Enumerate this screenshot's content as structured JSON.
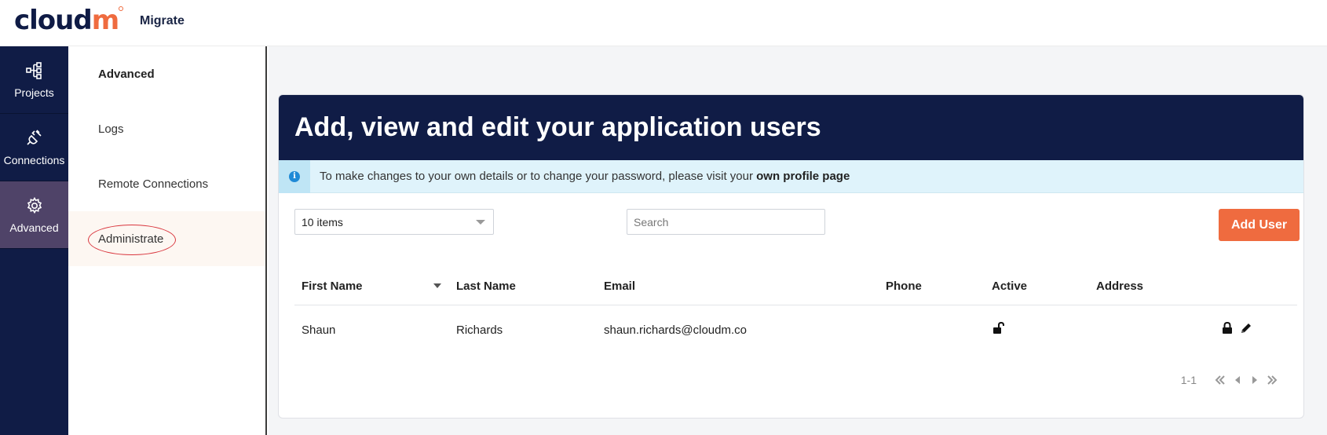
{
  "header": {
    "logo_main": "cloud",
    "logo_accent": "m",
    "app_title": "Migrate"
  },
  "rail": {
    "items": [
      {
        "label": "Projects",
        "icon": "project-tree-icon"
      },
      {
        "label": "Connections",
        "icon": "plug-icon"
      },
      {
        "label": "Advanced",
        "icon": "gear-icon",
        "active": true
      }
    ]
  },
  "subnav": {
    "heading": "Advanced",
    "items": [
      {
        "label": "Logs"
      },
      {
        "label": "Remote Connections"
      },
      {
        "label": "Administrate",
        "selected": true
      }
    ]
  },
  "card": {
    "title": "Add, view and edit your application users",
    "info_text": "To make changes to your own details or to change your password, please visit your",
    "info_link": "own profile page",
    "page_size": "10 items",
    "search_placeholder": "Search",
    "add_button": "Add User"
  },
  "table": {
    "columns": [
      "First Name",
      "Last Name",
      "Email",
      "Phone",
      "Active",
      "Address"
    ],
    "rows": [
      {
        "first_name": "Shaun",
        "last_name": "Richards",
        "email": "shaun.richards@cloudm.co",
        "phone": "",
        "active_icon": "unlock-icon",
        "address": ""
      }
    ]
  },
  "pager": {
    "range": "1-1"
  },
  "colors": {
    "navy": "#101c46",
    "accent": "#ef6b3f",
    "active_rail": "#4f4368",
    "info_bg": "#dff3fb"
  }
}
